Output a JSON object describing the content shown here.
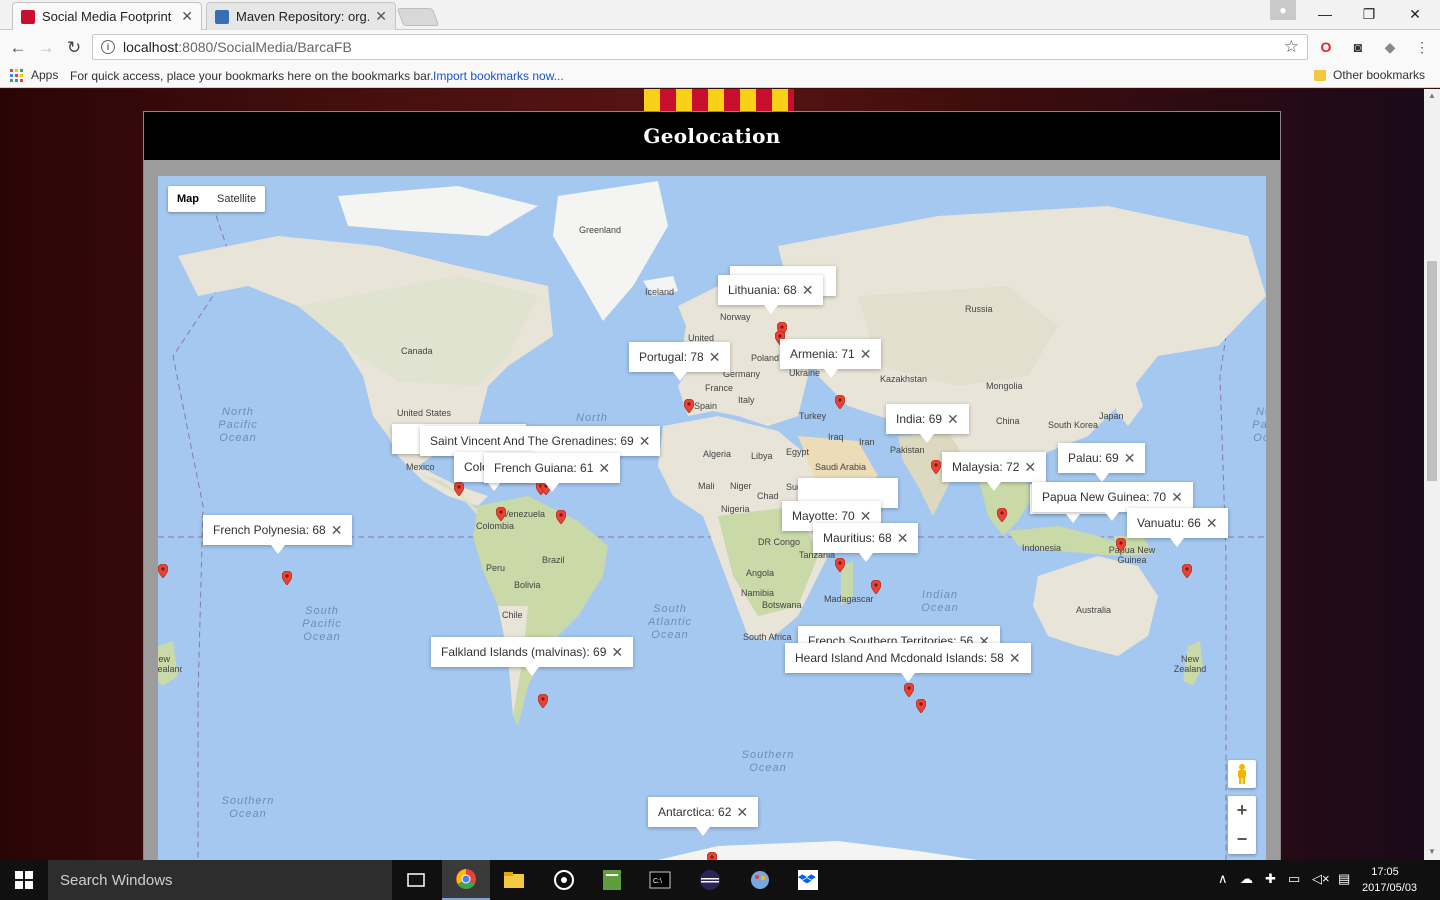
{
  "browser": {
    "tabs": [
      {
        "title": "Social Media Footprint",
        "favicon_color": "#c8102e"
      },
      {
        "title": "Maven Repository: org.m",
        "favicon_color": "#3b6db3"
      }
    ],
    "address": {
      "host": "localhost",
      "path": ":8080/SocialMedia/BarcaFB"
    },
    "bookmarks": {
      "apps_label": "Apps",
      "hint": "For quick access, place your bookmarks here on the bookmarks bar.",
      "import_link": "Import bookmarks now...",
      "other": "Other bookmarks"
    }
  },
  "page": {
    "heading": "Geolocation",
    "map_type": {
      "map": "Map",
      "satellite": "Satellite"
    },
    "map_labels": {
      "greenland": "Greenland",
      "iceland": "Iceland",
      "norway": "Norway",
      "russia": "Russia",
      "canada": "Canada",
      "united_states": "United States",
      "mexico": "Mexico",
      "united_kingdom": "United",
      "france": "France",
      "spain": "Spain",
      "germany": "Germany",
      "poland": "Poland",
      "ukraine": "Ukraine",
      "italy": "Italy",
      "turkey": "Turkey",
      "kazakhstan": "Kazakhstan",
      "mongolia": "Mongolia",
      "china": "China",
      "japan": "Japan",
      "south_korea": "South Korea",
      "iraq": "Iraq",
      "iran": "Iran",
      "pakistan": "Pakistan",
      "algeria": "Algeria",
      "libya": "Libya",
      "egypt": "Egypt",
      "saudi_arabia": "Saudi Arabia",
      "mali": "Mali",
      "niger": "Niger",
      "chad": "Chad",
      "sudan": "Sudan",
      "nigeria": "Nigeria",
      "dr_congo": "DR Congo",
      "tanzania": "Tanzania",
      "angola": "Angola",
      "namibia": "Namibia",
      "botswana": "Botswana",
      "south_africa": "South Africa",
      "madagascar": "Madagascar",
      "venezuela": "Venezuela",
      "colombia": "Colombia",
      "peru": "Peru",
      "brazil": "Brazil",
      "bolivia": "Bolivia",
      "chile": "Chile",
      "indonesia": "Indonesia",
      "australia": "Australia",
      "new_zealand": "New Zealand",
      "new_zealand_left": "New Zealand",
      "papua": "Papua New Guinea"
    },
    "oceans": {
      "north_pacific": "North Pacific Ocean",
      "north_atlantic": "North",
      "south_pacific": "South Pacific Ocean",
      "south_atlantic": "South Atlantic Ocean",
      "indian": "Indian Ocean",
      "southern_left": "Southern Ocean",
      "southern_mid": "Southern Ocean",
      "north_pacific_right": "North Pacific Ocean"
    },
    "infowindows": [
      {
        "id": "lithuania",
        "text": "Lithuania: 68"
      },
      {
        "id": "portugal",
        "text": "Portugal: 78"
      },
      {
        "id": "armenia",
        "text": "Armenia: 71"
      },
      {
        "id": "india",
        "text": "India: 69"
      },
      {
        "id": "malaysia",
        "text": "Malaysia: 72"
      },
      {
        "id": "palau",
        "text": "Palau: 69"
      },
      {
        "id": "png",
        "text": "Papua New Guinea: 70"
      },
      {
        "id": "vanuatu",
        "text": "Vanuatu: 66"
      },
      {
        "id": "svg",
        "text": "Saint Vincent And The Grenadines: 69"
      },
      {
        "id": "colombia",
        "text": "Colo"
      },
      {
        "id": "french_guiana",
        "text": "French Guiana: 61"
      },
      {
        "id": "french_polynesia",
        "text": "French Polynesia: 68"
      },
      {
        "id": "mayotte",
        "text": "Mayotte: 70"
      },
      {
        "id": "mauritius",
        "text": "Mauritius: 68"
      },
      {
        "id": "french_southern",
        "text": "French Southern Territories: 56"
      },
      {
        "id": "heard",
        "text": "Heard Island And Mcdonald Islands: 58"
      },
      {
        "id": "falkland",
        "text": "Falkland Islands (malvinas): 69"
      },
      {
        "id": "antarctica",
        "text": "Antarctica: 62"
      }
    ],
    "zoom": {
      "in": "+",
      "out": "−"
    }
  },
  "taskbar": {
    "search": "Search Windows",
    "time": "17:05",
    "date": "2017/05/03"
  },
  "colors": {
    "accent": "#1a55c8",
    "marker": "#ea4335",
    "water": "#a4c8f0",
    "land": "#e8e4d8"
  }
}
